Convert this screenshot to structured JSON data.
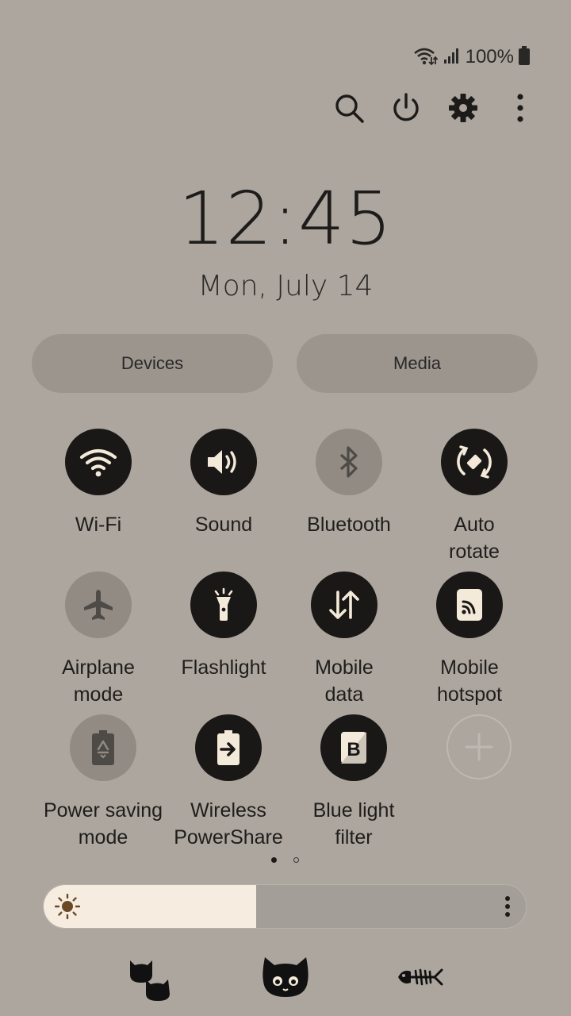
{
  "status_bar": {
    "wifi_icon": "wifi-calling-icon",
    "signal_icon": "cell-signal-icon",
    "battery_text": "100%",
    "battery_icon": "battery-full-icon"
  },
  "header": {
    "icons": [
      "search-icon",
      "power-icon",
      "gear-icon",
      "more-vert-icon"
    ]
  },
  "clock": {
    "time": "12:45",
    "date": "Mon, July 14"
  },
  "pills": {
    "devices": "Devices",
    "media": "Media"
  },
  "tiles": [
    {
      "label": "Wi-Fi",
      "state": "on",
      "icon": "wifi-icon"
    },
    {
      "label": "Sound",
      "state": "on",
      "icon": "speaker-icon"
    },
    {
      "label": "Bluetooth",
      "state": "off",
      "icon": "bluetooth-icon"
    },
    {
      "label": "Auto\nrotate",
      "state": "on",
      "icon": "auto-rotate-icon"
    },
    {
      "label": "Airplane\nmode",
      "state": "off",
      "icon": "airplane-icon"
    },
    {
      "label": "Flashlight",
      "state": "on",
      "icon": "flashlight-icon"
    },
    {
      "label": "Mobile\ndata",
      "state": "on",
      "icon": "mobile-data-icon"
    },
    {
      "label": "Mobile\nhotspot",
      "state": "on",
      "icon": "hotspot-icon"
    },
    {
      "label": "Power saving\nmode",
      "state": "off",
      "icon": "power-saving-icon"
    },
    {
      "label": "Wireless\nPowerShare",
      "state": "on",
      "icon": "wireless-powershare-icon"
    },
    {
      "label": "Blue light\nfilter",
      "state": "on",
      "icon": "blue-light-filter-icon"
    },
    {
      "label": "",
      "state": "add",
      "icon": "add-icon"
    }
  ],
  "pager": {
    "pages": 2,
    "current": 1
  },
  "brightness": {
    "level": 0.44,
    "icon": "sun-icon",
    "more_icon": "more-vert-icon"
  },
  "decorations": [
    "cat-heads-icon",
    "cat-face-icon",
    "fish-bone-icon"
  ],
  "colors": {
    "background": "#aca69e",
    "tile_on": "#1a1817",
    "tile_off": "#918b84",
    "brightness_fill": "#f6ecdf"
  }
}
